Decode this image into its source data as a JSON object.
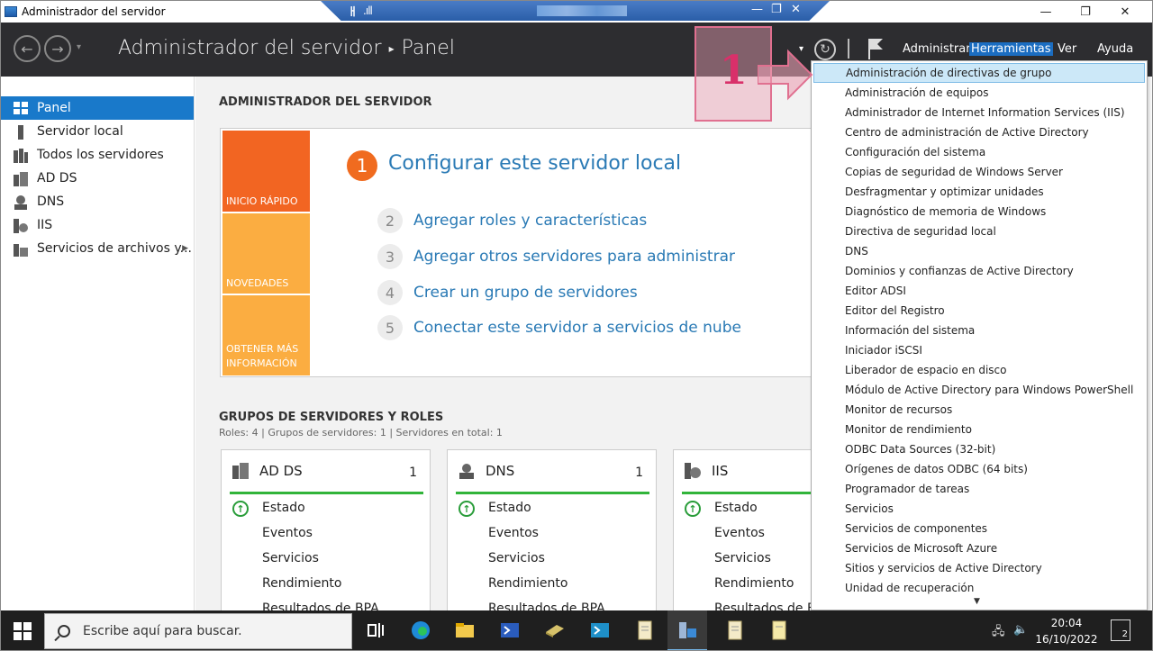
{
  "window": {
    "title": "Administrador del servidor",
    "minimize": "—",
    "maximize": "❐",
    "close": "✕"
  },
  "remote_bar": {
    "pin": "ㅐ",
    "signal": ".ıll",
    "minimize": "—",
    "restore": "❐",
    "close": "✕"
  },
  "header": {
    "title": "Administrador del servidor",
    "separator": "▸",
    "page": "Panel",
    "dropdown_arrow": "▾",
    "menus": {
      "administrar": "Administrar",
      "herramientas": "Herramientas",
      "ver": "Ver",
      "ayuda": "Ayuda"
    }
  },
  "sidebar": {
    "items": [
      {
        "label": "Panel"
      },
      {
        "label": "Servidor local"
      },
      {
        "label": "Todos los servidores"
      },
      {
        "label": "AD DS"
      },
      {
        "label": "DNS"
      },
      {
        "label": "IIS"
      },
      {
        "label": "Servicios de archivos y..."
      }
    ],
    "expand_arrow": "▶"
  },
  "main": {
    "title": "ADMINISTRADOR DEL SERVIDOR",
    "tiles": {
      "quick_start": "INICIO RÁPIDO",
      "news": "NOVEDADES",
      "learn_more": "OBTENER MÁS INFORMACIÓN"
    },
    "steps": [
      {
        "num": "1",
        "label": "Configurar este servidor local"
      },
      {
        "num": "2",
        "label": "Agregar roles y características"
      },
      {
        "num": "3",
        "label": "Agregar otros servidores para administrar"
      },
      {
        "num": "4",
        "label": "Crear un grupo de servidores"
      },
      {
        "num": "5",
        "label": "Conectar este servidor a servicios de nube"
      }
    ],
    "groups_title": "GRUPOS DE SERVIDORES Y ROLES",
    "groups_info": "Roles: 4   |   Grupos de servidores: 1   |   Servidores en total: 1",
    "cards": [
      {
        "name": "AD DS",
        "count": "1",
        "rows": [
          "Estado",
          "Eventos",
          "Servicios",
          "Rendimiento",
          "Resultados de BPA"
        ]
      },
      {
        "name": "DNS",
        "count": "1",
        "rows": [
          "Estado",
          "Eventos",
          "Servicios",
          "Rendimiento",
          "Resultados de BPA"
        ]
      },
      {
        "name": "IIS",
        "count": "",
        "rows": [
          "Estado",
          "Eventos",
          "Servicios",
          "Rendimiento",
          "Resultados de BPA"
        ]
      }
    ]
  },
  "tools_menu": {
    "items": [
      "Administración de directivas de grupo",
      "Administración de equipos",
      "Administrador de Internet Information Services (IIS)",
      "Centro de administración de Active Directory",
      "Configuración del sistema",
      "Copias de seguridad de Windows Server",
      "Desfragmentar y optimizar unidades",
      "Diagnóstico de memoria de Windows",
      "Directiva de seguridad local",
      "DNS",
      "Dominios y confianzas de Active Directory",
      "Editor ADSI",
      "Editor del Registro",
      "Información del sistema",
      "Iniciador iSCSI",
      "Liberador de espacio en disco",
      "Módulo de Active Directory para Windows PowerShell",
      "Monitor de recursos",
      "Monitor de rendimiento",
      "ODBC Data Sources (32-bit)",
      "Orígenes de datos ODBC (64 bits)",
      "Programador de tareas",
      "Servicios",
      "Servicios de componentes",
      "Servicios de Microsoft Azure",
      "Sitios y servicios de Active Directory",
      "Unidad de recuperación"
    ],
    "more_arrow": "▼"
  },
  "annotation": {
    "label": "1"
  },
  "taskbar": {
    "search_placeholder": "Escribe aquí para buscar.",
    "time": "20:04",
    "date": "16/10/2022",
    "notifications": "2"
  }
}
